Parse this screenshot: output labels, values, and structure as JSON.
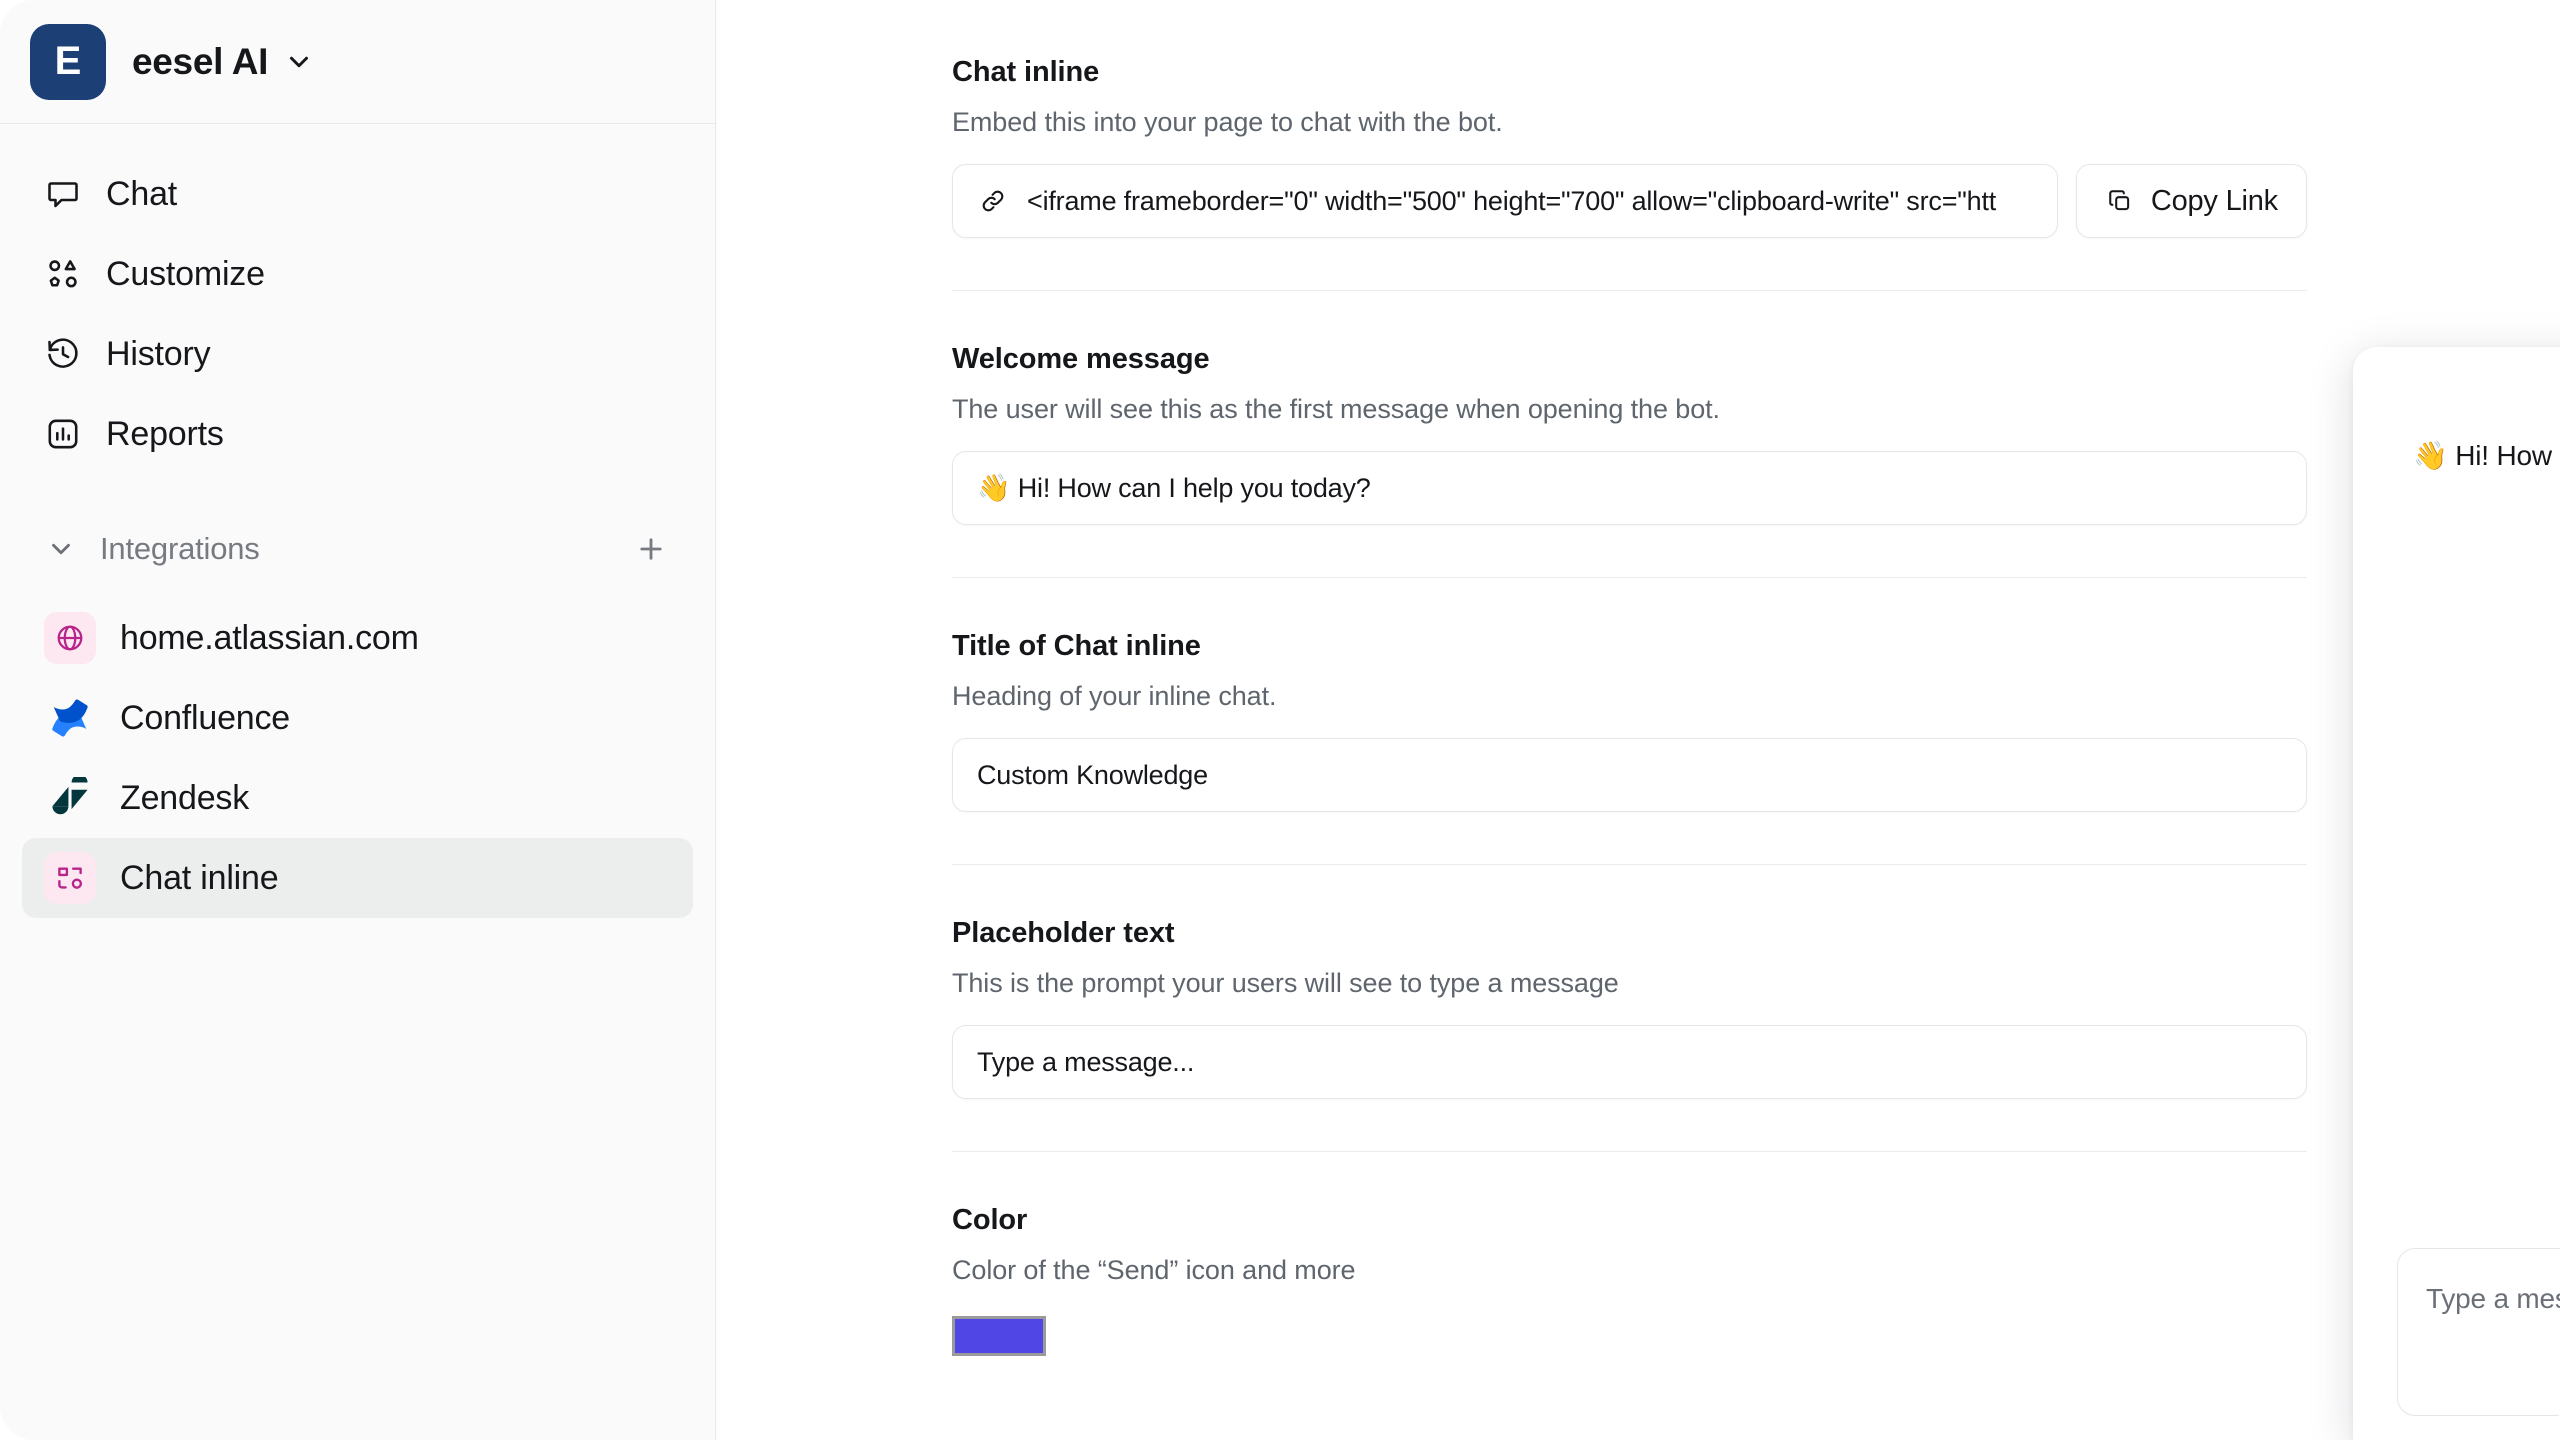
{
  "workspace": {
    "logo_letter": "E",
    "name": "eesel AI",
    "caret_icon": "chevron-down-icon"
  },
  "sidebar": {
    "primary_items": [
      {
        "label": "Chat",
        "icon": "chat-bubble-icon",
        "selected": false
      },
      {
        "label": "Customize",
        "icon": "shapes-icon",
        "selected": false
      },
      {
        "label": "History",
        "icon": "history-clock-icon",
        "selected": false
      },
      {
        "label": "Reports",
        "icon": "bar-chart-icon",
        "selected": false
      }
    ],
    "integrations": {
      "label": "Integrations",
      "collapse_icon": "chevron-down-icon",
      "add_icon": "plus-icon",
      "items": [
        {
          "label": "home.atlassian.com",
          "icon": "globe-icon",
          "selected": false
        },
        {
          "label": "Confluence",
          "icon": "confluence-icon",
          "selected": false
        },
        {
          "label": "Zendesk",
          "icon": "zendesk-icon",
          "selected": false
        },
        {
          "label": "Chat inline",
          "icon": "chat-inline-icon",
          "selected": true
        }
      ]
    }
  },
  "main": {
    "embed": {
      "title": "Chat inline",
      "subtitle": "Embed this into your page to chat with the bot.",
      "link_icon": "link-icon",
      "value": "<iframe frameborder=\"0\" width=\"500\" height=\"700\" allow=\"clipboard-write\" src=\"htt",
      "copy_button_label": "Copy Link",
      "copy_button_icon": "copy-icon"
    },
    "welcome": {
      "title": "Welcome message",
      "subtitle": "The user will see this as the first message when opening the bot.",
      "value": "👋 Hi! How can I help you today?"
    },
    "chat_title": {
      "title": "Title of Chat inline",
      "subtitle": "Heading of your inline chat.",
      "value": "Custom Knowledge"
    },
    "placeholder": {
      "title": "Placeholder text",
      "subtitle": "This is the prompt your users will see to type a message",
      "value": "Type a message..."
    },
    "color": {
      "title": "Color",
      "subtitle": "Color of the “Send” icon and more",
      "value": "#4f46e5"
    }
  },
  "preview": {
    "bot_message": "👋 Hi! How can I help you today?",
    "composer_placeholder": "Type a message...",
    "send_icon": "send-icon",
    "accent_color": "#4f46e5"
  }
}
